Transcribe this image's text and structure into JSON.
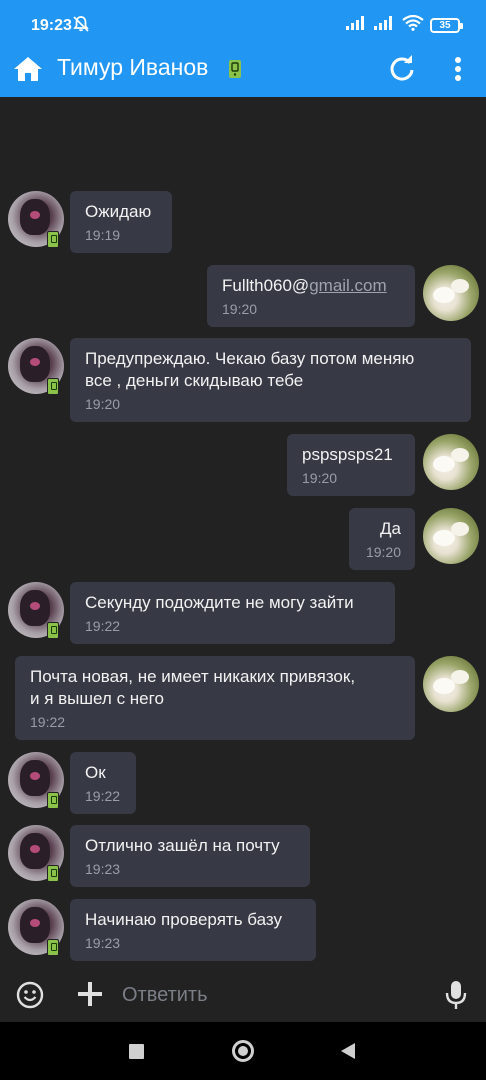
{
  "status": {
    "time": "19:23",
    "battery": "35"
  },
  "header": {
    "title": "Тимур Иванов"
  },
  "messages": [
    {
      "side": "peer",
      "text": "Ожидаю",
      "time": "19:19"
    },
    {
      "side": "me",
      "text_user": "Fullth060@",
      "text_link": "gmail.com",
      "time": "19:20"
    },
    {
      "side": "peer",
      "line1": "Предупреждаю. Чекаю базу потом меняю",
      "line2": "все , деньги скидываю тебе",
      "time": "19:20"
    },
    {
      "side": "me",
      "text": "pspspsps21",
      "time": "19:20"
    },
    {
      "side": "me",
      "text": "Да",
      "time": "19:20"
    },
    {
      "side": "peer",
      "text": "Секунду подождите не могу зайти",
      "time": "19:22"
    },
    {
      "side": "me",
      "line1": "Почта новая, не имеет никаких привязок,",
      "line2": "и я вышел с него",
      "time": "19:22"
    },
    {
      "side": "peer",
      "text": "Ок",
      "time": "19:22"
    },
    {
      "side": "peer",
      "text": "Отлично зашёл на почту",
      "time": "19:23"
    },
    {
      "side": "peer",
      "text": "Начинаю проверять базу",
      "time": "19:23"
    }
  ],
  "composer": {
    "placeholder": "Ответить"
  },
  "colors": {
    "accent": "#2196f3",
    "bubble": "#373a45",
    "background": "#222222",
    "device_badge": "#8bc34a"
  },
  "icons": [
    "home-icon",
    "device-icon",
    "refresh-icon",
    "more-vert-icon",
    "emoji-icon",
    "plus-icon",
    "mic-icon"
  ]
}
